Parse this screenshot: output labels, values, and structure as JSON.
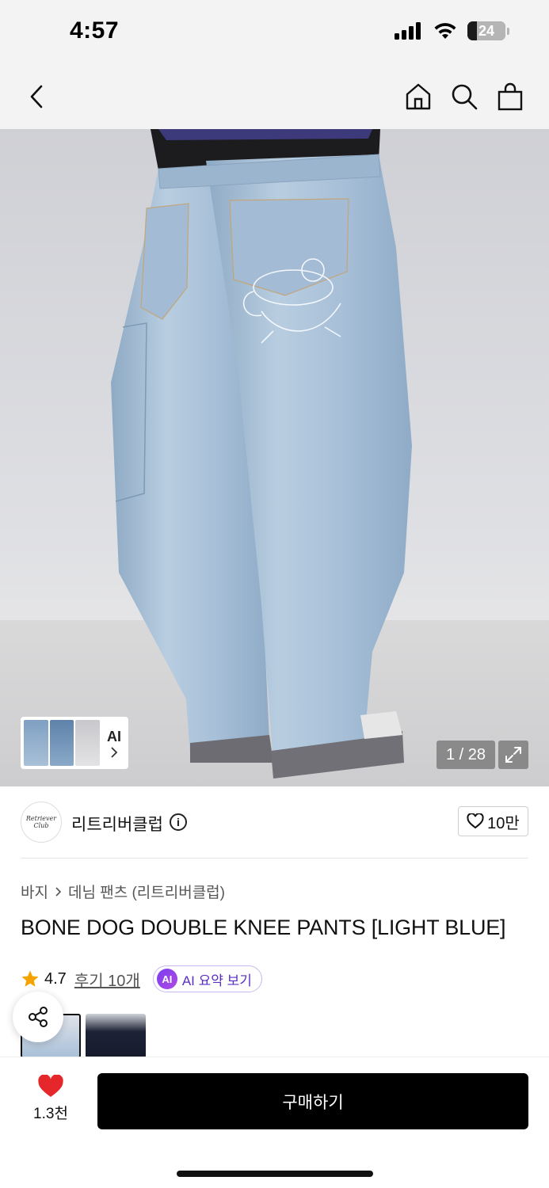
{
  "status_bar": {
    "time": "4:57",
    "battery": "24",
    "battery_level": 0.24
  },
  "nav": {
    "back": "back-arrow-icon",
    "home": "home-icon",
    "search": "search-icon",
    "cart": "shopping-bag-icon"
  },
  "hero": {
    "thumb_label": "AI",
    "counter": "1 / 28"
  },
  "brand": {
    "logo_text": "Retriever Club",
    "name": "리트리버클럽",
    "info": "i",
    "likes": "10만"
  },
  "breadcrumb": {
    "category": "바지",
    "subcategory": "데님 팬츠 (리트리버클럽)"
  },
  "product": {
    "title": "BONE DOG DOUBLE KNEE PANTS [LIGHT BLUE]",
    "rating": "4.7",
    "reviews": "후기 10개",
    "ai_badge": "AI",
    "ai_summary": "AI 요약 보기"
  },
  "bottom": {
    "wish_count": "1.3천",
    "buy_label": "구매하기"
  },
  "colors": {
    "accent_purple": "#5a2fc2",
    "heart_red": "#e5262a",
    "star_orange": "#f4a300",
    "denim": "#a9c0d8"
  }
}
